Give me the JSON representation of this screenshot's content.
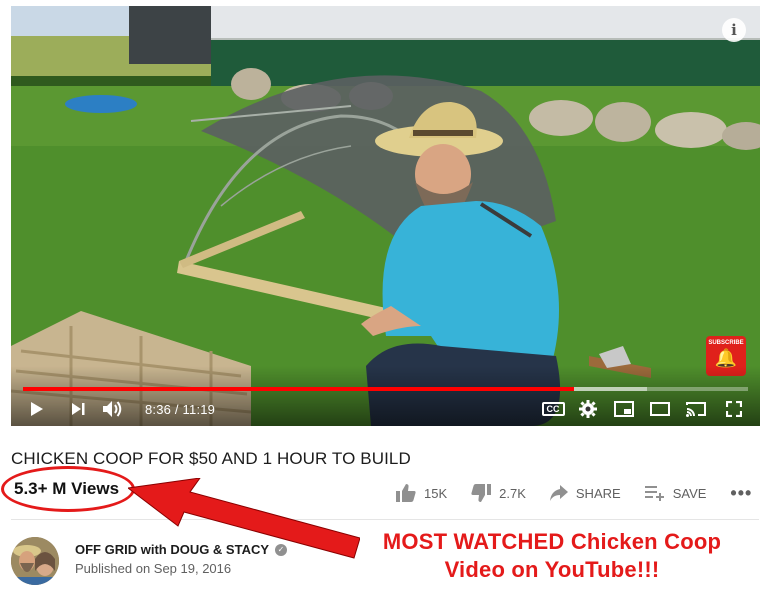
{
  "player": {
    "time_current": "8:36",
    "time_total": "11:19",
    "time_separator": "/",
    "progress": 0.76,
    "buffered": 0.86,
    "subscribe_badge": "SUBSCRIBE",
    "cc_label": "CC",
    "info_label": "i"
  },
  "video": {
    "title": "CHICKEN COOP FOR $50 AND 1 HOUR TO BUILD",
    "views": "5.3+ M Views"
  },
  "actions": {
    "likes": "15K",
    "dislikes": "2.7K",
    "share": "SHARE",
    "save": "SAVE",
    "more": "•••"
  },
  "channel": {
    "name": "OFF GRID with DOUG & STACY",
    "published": "Published on Sep 19, 2016"
  },
  "annotation": {
    "line1": "MOST WATCHED Chicken Coop",
    "line2": "Video on YouTube!!!"
  },
  "colors": {
    "accent_red": "#e41a1a",
    "progress_red": "#ff0000"
  },
  "icons": [
    "play-icon",
    "next-icon",
    "volume-icon",
    "cc-icon",
    "settings-icon",
    "miniplayer-icon",
    "theater-icon",
    "cast-icon",
    "fullscreen-icon",
    "thumbs-up-icon",
    "thumbs-down-icon",
    "share-icon",
    "save-playlist-icon",
    "more-icon",
    "verified-icon",
    "info-icon"
  ]
}
